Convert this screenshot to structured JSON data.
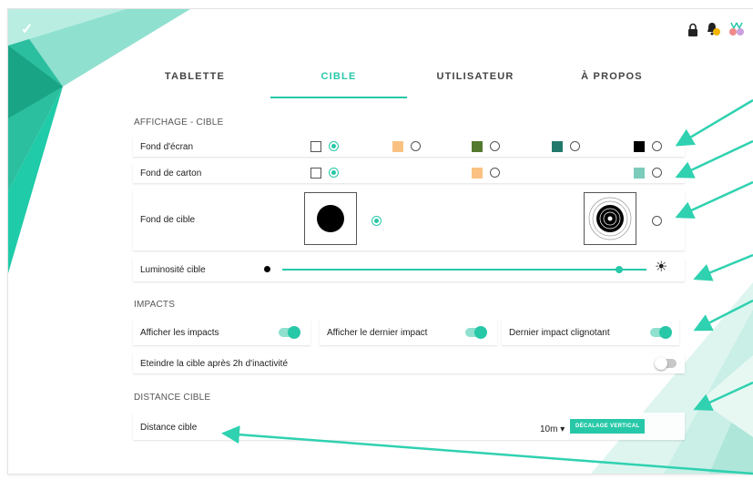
{
  "colors": {
    "accent": "#27c8a8",
    "arrow": "#2fd1b0"
  },
  "header": {
    "check_icon": "checkmark-icon",
    "icons": [
      "lock-icon",
      "notification-bell-icon",
      "medals-icon"
    ]
  },
  "tabs": [
    {
      "label": "TABLETTE",
      "active": false
    },
    {
      "label": "CIBLE",
      "active": true
    },
    {
      "label": "UTILISATEUR",
      "active": false
    },
    {
      "label": "À PROPOS",
      "active": false
    }
  ],
  "sections": {
    "display": "AFFICHAGE - CIBLE",
    "impacts": "IMPACTS",
    "distance": "DISTANCE CIBLE"
  },
  "rows": {
    "screen_bg": {
      "label": "Fond d'écran",
      "options": [
        "#ffffff",
        "#f9c282",
        "#537a2f",
        "#237a6c",
        "#000000"
      ],
      "selected": 0
    },
    "card_bg": {
      "label": "Fond de carton",
      "options": [
        "#ffffff",
        "#f9c282",
        "#7ccbbb"
      ],
      "selected": 0
    },
    "target_bg": {
      "label": "Fond de cible",
      "options": [
        "black-disc-target",
        "ring-target"
      ],
      "selected": 0
    },
    "brightness": {
      "label": "Luminosité cible",
      "value": 0.94
    },
    "impacts": [
      {
        "label": "Afficher les impacts",
        "on": true
      },
      {
        "label": "Afficher le dernier impact",
        "on": true
      },
      {
        "label": "Dernier impact clignotant",
        "on": true
      }
    ],
    "sleep": {
      "label": "Eteindre la cible après 2h d'inactivité",
      "on": false
    },
    "distance": {
      "label": "Distance cible",
      "value": "10m",
      "button": "DÉCALAGE VERTICAL"
    }
  }
}
